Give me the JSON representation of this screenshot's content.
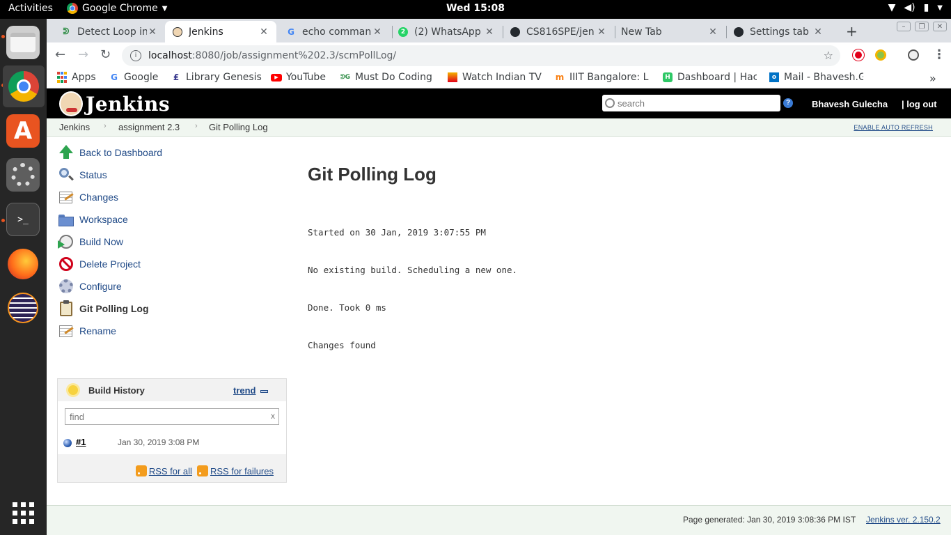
{
  "system": {
    "activities": "Activities",
    "app_name": "Google Chrome",
    "clock": "Wed 15:08"
  },
  "tabs": [
    {
      "title": "Detect Loop in",
      "icon": "geeksforgeeks-icon"
    },
    {
      "title": "Jenkins",
      "icon": "jenkins-icon",
      "active": true
    },
    {
      "title": "echo comman",
      "icon": "google-icon"
    },
    {
      "title": "(2) WhatsApp",
      "icon": "whatsapp-icon"
    },
    {
      "title": "CS816SPE/jen",
      "icon": "github-icon"
    },
    {
      "title": "New Tab",
      "icon": ""
    },
    {
      "title": "Settings tab d",
      "icon": "github-icon"
    }
  ],
  "address": {
    "host": "localhost",
    "path": ":8080/job/assignment%202.3/scmPollLog/"
  },
  "bookmarks": [
    {
      "label": "Apps",
      "icon": "apps-grid-icon"
    },
    {
      "label": "Google",
      "icon": "google-icon"
    },
    {
      "label": "Library Genesis",
      "icon": "library-genesis-icon"
    },
    {
      "label": "YouTube",
      "icon": "youtube-icon"
    },
    {
      "label": "Must Do Coding",
      "icon": "geeksforgeeks-icon"
    },
    {
      "label": "Watch Indian TV",
      "icon": "tv-icon"
    },
    {
      "label": "IIIT Bangalore: L",
      "icon": "moodle-icon"
    },
    {
      "label": "Dashboard | Hac",
      "icon": "hackerrank-icon"
    },
    {
      "label": "Mail - Bhavesh.G",
      "icon": "outlook-icon"
    }
  ],
  "jenkins": {
    "logo_text": "Jenkins",
    "search_placeholder": "search",
    "user": "Bhavesh Gulecha",
    "logout": "| log out",
    "breadcrumbs": [
      "Jenkins",
      "assignment 2.3",
      "Git Polling Log"
    ],
    "auto_refresh": "ENABLE AUTO REFRESH",
    "tasks": [
      {
        "label": "Back to Dashboard",
        "icon": "up-arrow-icon"
      },
      {
        "label": "Status",
        "icon": "magnifier-icon"
      },
      {
        "label": "Changes",
        "icon": "notepad-icon"
      },
      {
        "label": "Workspace",
        "icon": "folder-icon"
      },
      {
        "label": "Build Now",
        "icon": "clock-play-icon"
      },
      {
        "label": "Delete Project",
        "icon": "no-entry-icon"
      },
      {
        "label": "Configure",
        "icon": "gear-icon"
      },
      {
        "label": "Git Polling Log",
        "icon": "clipboard-icon",
        "current": true
      },
      {
        "label": "Rename",
        "icon": "notepad-icon"
      }
    ],
    "build_history": {
      "title": "Build History",
      "trend": "trend",
      "find_placeholder": "find",
      "clear": "x",
      "builds": [
        {
          "number": "#1",
          "date": "Jan 30, 2019 3:08 PM",
          "status_color": "#2d5fb3"
        }
      ],
      "rss_all": "RSS for all",
      "rss_failures": "RSS for failures"
    },
    "main": {
      "title": "Git Polling Log",
      "log_lines": [
        "Started on 30 Jan, 2019 3:07:55 PM",
        "No existing build. Scheduling a new one.",
        "Done. Took 0 ms",
        "Changes found"
      ]
    },
    "footer": {
      "generated": "Page generated: Jan 30, 2019 3:08:36 PM IST",
      "version": "Jenkins ver. 2.150.2"
    }
  }
}
